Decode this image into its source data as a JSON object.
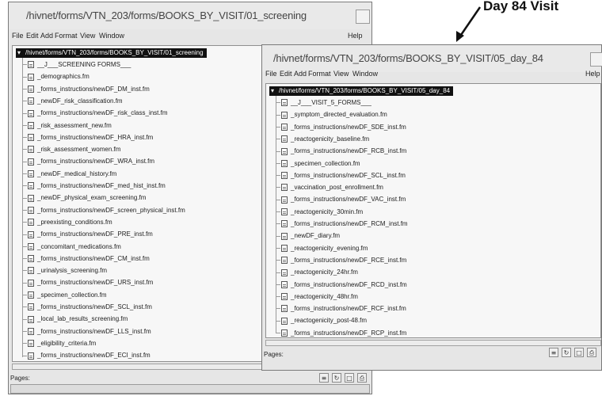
{
  "annotation": "Day 84 Visit",
  "window1": {
    "title": "/hivnet/forms/VTN_203/forms/BOOKS_BY_VISIT/01_screening",
    "menu": [
      "File",
      "Edit",
      "Add",
      "Format",
      "View",
      "Window"
    ],
    "help": "Help",
    "root_path": "/hivnet/forms/VTN_203/forms/BOOKS_BY_VISIT/01_screening",
    "items": [
      "__J___SCREENING FORMS___",
      "_demographics.fm",
      "_forms_instructions/newDF_DM_inst.fm",
      "_newDF_risk_classification.fm",
      "_forms_instructions/newDF_risk_class_inst.fm",
      "_risk_assessment_new.fm",
      "_forms_instructions/newDF_HRA_inst.fm",
      "_risk_assessment_women.fm",
      "_forms_instructions/newDF_WRA_inst.fm",
      "_newDF_medical_history.fm",
      "_forms_instructions/newDF_med_hist_inst.fm",
      "_newDF_physical_exam_screening.fm",
      "_forms_instructions/newDF_screen_physical_inst.fm",
      "_preexisting_conditions.fm",
      "_forms_instructions/newDF_PRE_inst.fm",
      "_concomitant_medications.fm",
      "_forms_instructions/newDF_CM_inst.fm",
      "_urinalysis_screening.fm",
      "_forms_instructions/newDF_URS_inst.fm",
      "_specimen_collection.fm",
      "_forms_instructions/newDF_SCL_inst.fm",
      "_local_lab_results_screening.fm",
      "_forms_instructions/newDF_LLS_inst.fm",
      "_eligibility_criteria.fm",
      "_forms_instructions/newDF_ECI_inst.fm"
    ],
    "pages_label": "Pages:"
  },
  "window2": {
    "title": "/hivnet/forms/VTN_203/forms/BOOKS_BY_VISIT/05_day_84",
    "menu": [
      "File",
      "Edit",
      "Add",
      "Format",
      "View",
      "Window"
    ],
    "help": "Help",
    "root_path": "/hivnet/forms/VTN_203/forms/BOOKS_BY_VISIT/05_day_84",
    "items": [
      "__J___VISIT_5_FORMS___",
      "_symptom_directed_evaluation.fm",
      "_forms_instructions/newDF_SDE_inst.fm",
      "_reactogenicity_baseline.fm",
      "_forms_instructions/newDF_RCB_inst.fm",
      "_specimen_collection.fm",
      "_forms_instructions/newDF_SCL_inst.fm",
      "_vaccination_post_enrollment.fm",
      "_forms_instructions/newDF_VAC_inst.fm",
      "_reactogenicity_30min.fm",
      "_forms_instructions/newDF_RCM_inst.fm",
      "_newDF_diary.fm",
      "_reactogenicity_evening.fm",
      "_forms_instructions/newDF_RCE_inst.fm",
      "_reactogenicity_24hr.fm",
      "_forms_instructions/newDF_RCD_inst.fm",
      "_reactogenicity_48hr.fm",
      "_forms_instructions/newDF_RCF_inst.fm",
      "_reactogenicity_post-48.fm",
      "_forms_instructions/newDF_RCP_inst.fm"
    ],
    "pages_label": "Pages:"
  }
}
